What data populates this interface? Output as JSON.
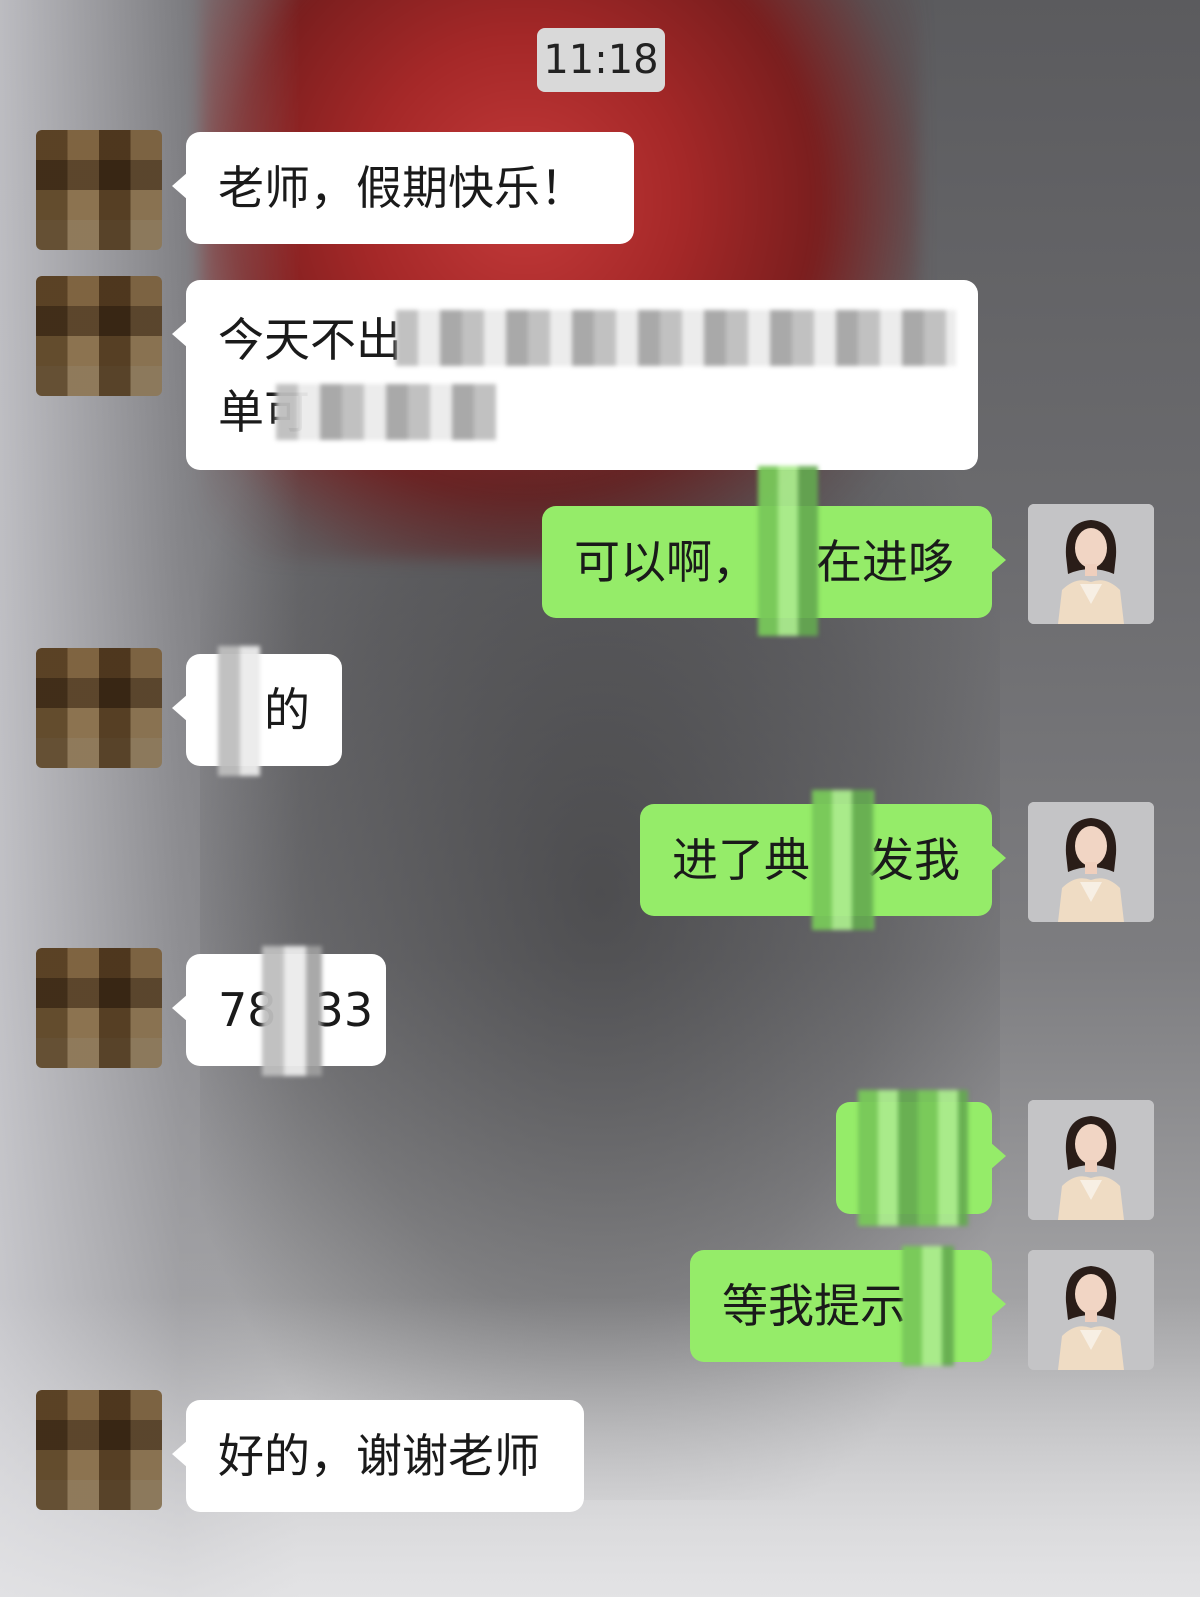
{
  "timestamp": "11:18",
  "messages": [
    {
      "sender": "student",
      "text_lines": [
        "老师，假期快乐！"
      ]
    },
    {
      "sender": "student",
      "text_lines": [
        "今天不出",
        "单可"
      ],
      "redacted": true
    },
    {
      "sender": "teacher",
      "text_lines": [
        "可以啊，",
        "在进哆"
      ],
      "redacted": true
    },
    {
      "sender": "student",
      "text_lines": [
        "的"
      ],
      "redacted": true
    },
    {
      "sender": "teacher",
      "text_lines": [
        "进了典",
        "发我"
      ],
      "redacted": true
    },
    {
      "sender": "student",
      "text_lines": [
        "78",
        "33"
      ],
      "redacted": true
    },
    {
      "sender": "teacher",
      "text_lines": [],
      "redacted": true
    },
    {
      "sender": "teacher",
      "text_lines": [
        "等我提示"
      ],
      "redacted": true
    },
    {
      "sender": "student",
      "text_lines": [
        "好的，谢谢老师"
      ]
    }
  ],
  "colors": {
    "outgoing_bubble": "#95ec69",
    "incoming_bubble": "#ffffff",
    "timestamp_bg": "#d9d9d9"
  },
  "icons": {
    "student_avatar": "pixelated-avatar",
    "teacher_avatar": "woman-portrait-avatar"
  }
}
